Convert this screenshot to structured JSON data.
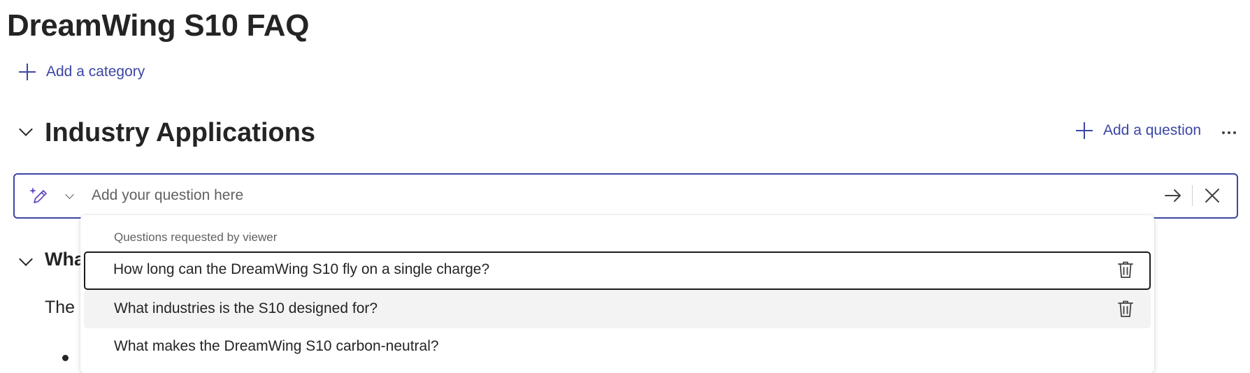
{
  "page": {
    "title": "DreamWing S10 FAQ"
  },
  "toolbar": {
    "add_category_label": "Add a category"
  },
  "section": {
    "title": "Industry Applications",
    "add_question_label": "Add a question"
  },
  "question_input": {
    "placeholder": "Add your question here",
    "value": ""
  },
  "dropdown": {
    "heading": "Questions requested by viewer",
    "items": [
      {
        "text": "How long can the DreamWing S10 fly on a single charge?",
        "state": "focused"
      },
      {
        "text": "What industries is the S10 designed for?",
        "state": "hovered"
      },
      {
        "text": "What makes the DreamWing S10 carbon-neutral?",
        "state": "normal"
      }
    ]
  },
  "background_item": {
    "title_visible": "Wha",
    "text_visible": "The"
  },
  "icons": {
    "add": "plus-icon",
    "more": "more-horizontal-icon",
    "ai": "sparkle-pen-icon",
    "send": "arrow-right-icon",
    "close": "close-icon",
    "delete": "trash-icon",
    "collapse": "chevron-down-icon"
  },
  "colors": {
    "accent": "#3b46a5",
    "text": "#242424",
    "muted": "#616161",
    "hover_bg": "#f3f3f3",
    "ai_gradient_start": "#3b46a5",
    "ai_gradient_end": "#8a4fe0"
  }
}
